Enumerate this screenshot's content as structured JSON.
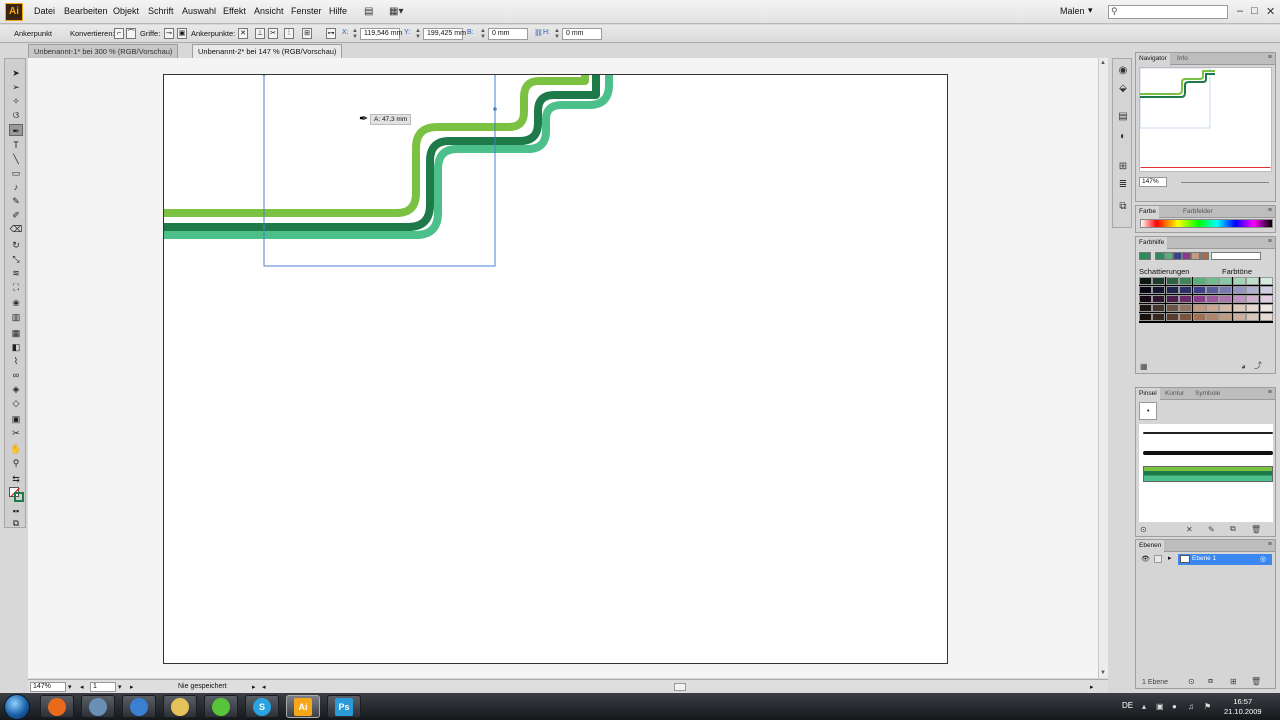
{
  "app": {
    "logo": "Ai"
  },
  "menubar": {
    "items": [
      "Datei",
      "Bearbeiten",
      "Objekt",
      "Schrift",
      "Auswahl",
      "Effekt",
      "Ansicht",
      "Fenster",
      "Hilfe"
    ],
    "workspace": "Malen",
    "search_placeholder": ""
  },
  "controlbar": {
    "tool_label": "Ankerpunkt",
    "convert_label": "Konvertieren:",
    "handles_label": "Griffe:",
    "anchor_points_label": "Ankerpunkte:",
    "x_label": "X:",
    "x_value": "119,546 mm",
    "y_label": "Y:",
    "y_value": "199,425 mm",
    "w_label": "B:",
    "w_value": "0 mm",
    "h_label": "H:",
    "h_value": "0 mm"
  },
  "tabs": [
    {
      "label": "Unbenannt-1* bei 300 % (RGB/Vorschau)",
      "active": false
    },
    {
      "label": "Unbenannt-2* bei 147 % (RGB/Vorschau)",
      "active": true
    }
  ],
  "canvas": {
    "tooltip": "A: 47,3 mm",
    "colors": {
      "light_green": "#7cc242",
      "dark_green": "#1f7a4a",
      "mint_green": "#4cbf8a",
      "selection": "#4a7fd0"
    }
  },
  "statusbar": {
    "zoom": "147%",
    "artboard": "1",
    "status": "Nie gespeichert"
  },
  "navigator": {
    "tabs": [
      "Navigator",
      "Info"
    ],
    "zoom": "147%"
  },
  "color_panel": {
    "tabs": [
      "Farbe",
      "Farbfelder"
    ]
  },
  "color_guide": {
    "title": "Farbhilfe",
    "col_shades": "Schattierungen",
    "col_tints": "Farbtöne",
    "harmony": [
      "#2f8a5a",
      "#55b07a",
      "#3a3f8a",
      "#8a3a8a",
      "#c49a80",
      "#a07050"
    ]
  },
  "brushes_panel": {
    "tabs": [
      "Pinsel",
      "Kontur",
      "Symbole"
    ]
  },
  "layers_panel": {
    "title": "Ebenen",
    "layer_name": "Ebene 1",
    "count": "1 Ebene"
  },
  "taskbar": {
    "apps": [
      {
        "name": "firefox",
        "label": ""
      },
      {
        "name": "explorer",
        "label": ""
      },
      {
        "name": "media",
        "label": ""
      },
      {
        "name": "folder",
        "label": ""
      },
      {
        "name": "icq",
        "label": ""
      },
      {
        "name": "skype",
        "label": "S"
      },
      {
        "name": "illustrator",
        "label": "Ai"
      },
      {
        "name": "photoshop",
        "label": "Ps"
      }
    ],
    "lang": "DE",
    "time": "16:57",
    "date": "21.10.2009"
  }
}
